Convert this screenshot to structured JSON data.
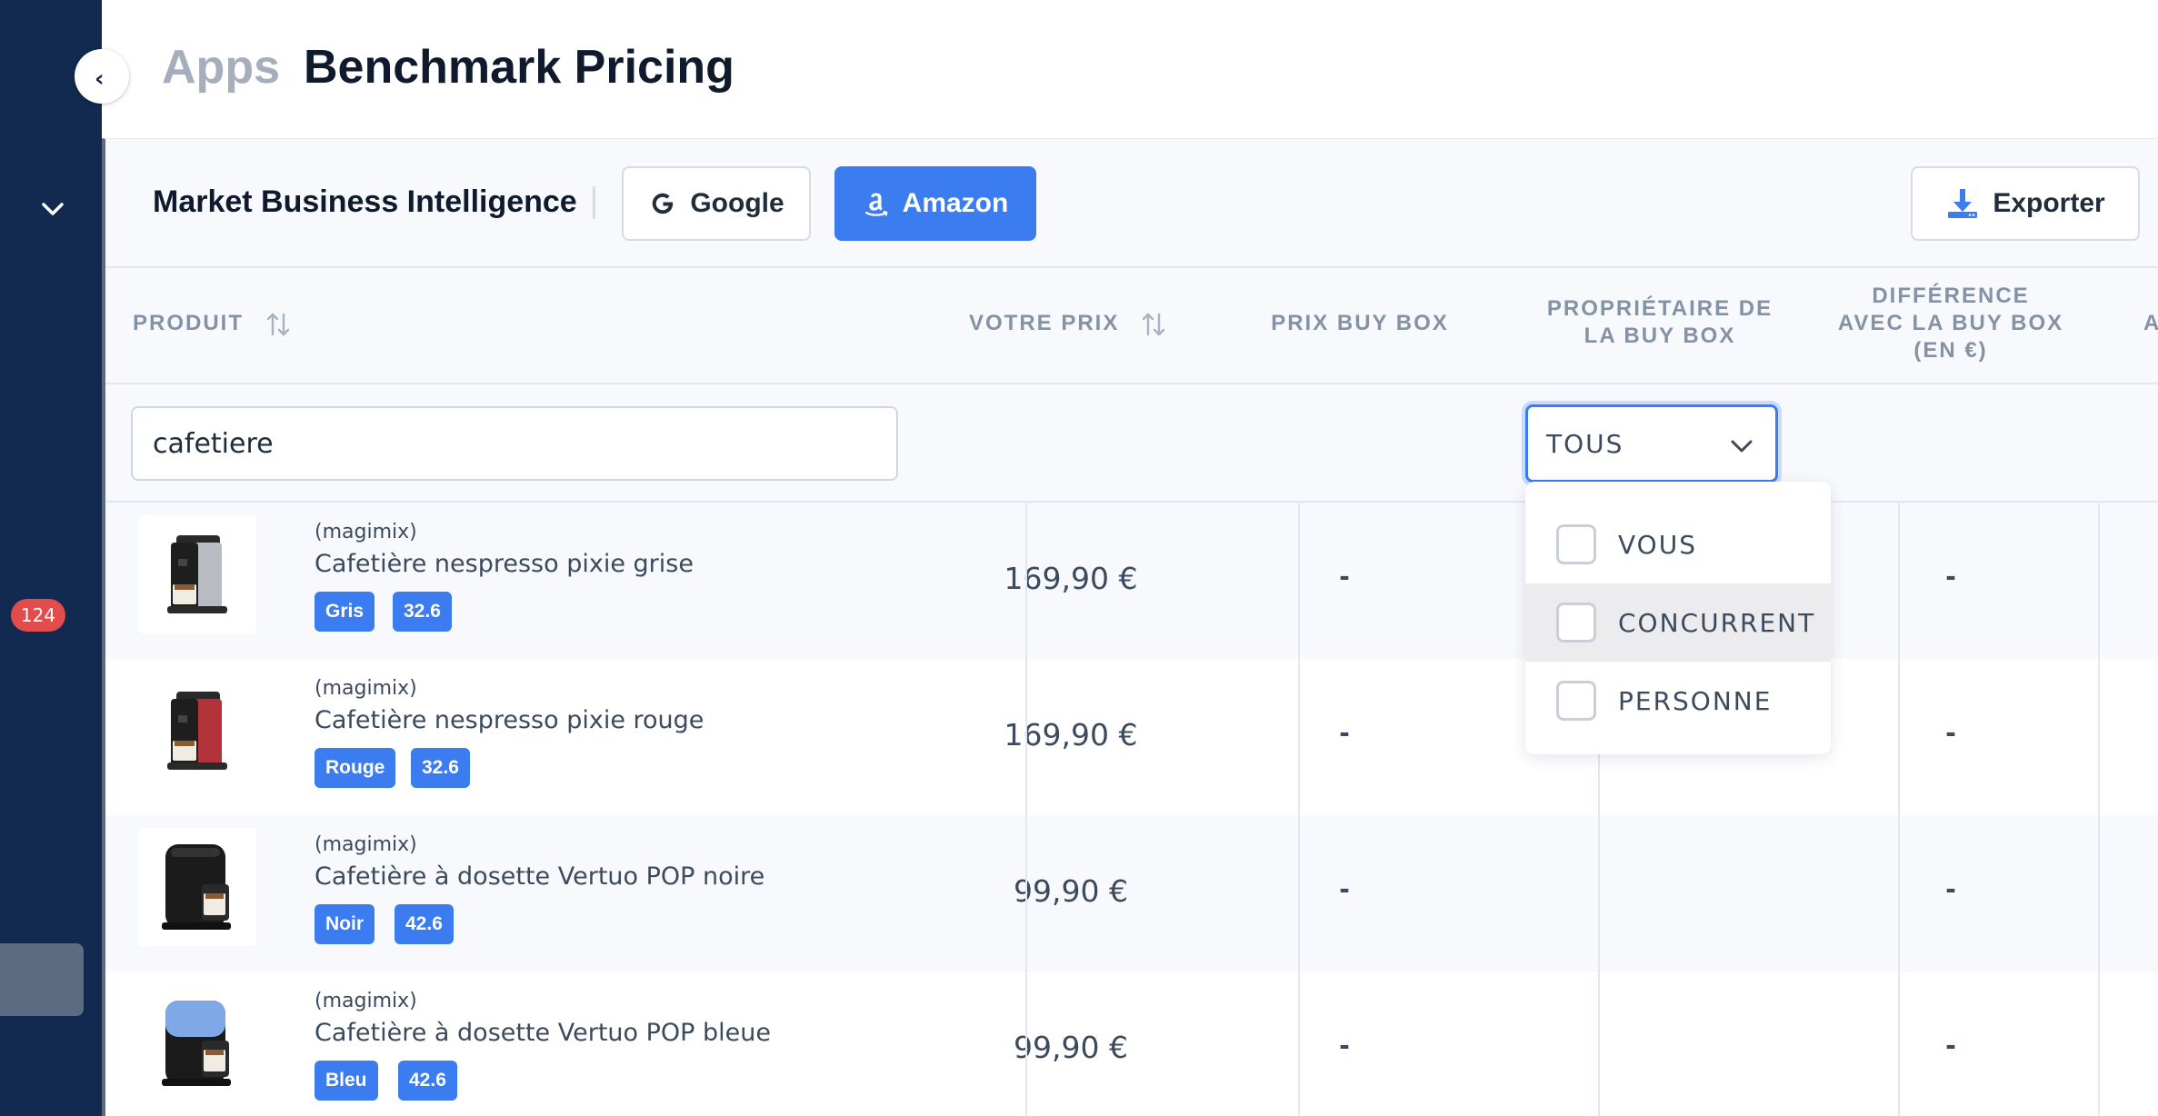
{
  "header": {
    "breadcrumb": "Apps",
    "title": "Benchmark Pricing"
  },
  "sidebar": {
    "badge_count": "124"
  },
  "toolbar": {
    "label": "Market Business Intelligence",
    "google_label": "Google",
    "amazon_label": "Amazon",
    "export_label": "Exporter"
  },
  "table": {
    "columns": {
      "product": "PRODUIT",
      "your_price": "VOTRE PRIX",
      "buybox_price": "PRIX BUY BOX",
      "buybox_owner_l1": "PROPRIÉTAIRE DE",
      "buybox_owner_l2": "LA BUY BOX",
      "diff_l1": "DIFFÉRENCE",
      "diff_l2": "AVEC LA BUY BOX",
      "diff_l3": "(EN €)",
      "next_partial": "A"
    },
    "filters": {
      "search_value": "cafetiere",
      "owner_selected": "TOUS"
    },
    "rows": [
      {
        "brand": "(magimix)",
        "name": "Cafetière nespresso pixie grise",
        "color_tag": "Gris",
        "size_tag": "32.6",
        "price": "169,90 €",
        "buybox_price": "-",
        "diff": "-"
      },
      {
        "brand": "(magimix)",
        "name": "Cafetière nespresso pixie rouge",
        "color_tag": "Rouge",
        "size_tag": "32.6",
        "price": "169,90 €",
        "buybox_price": "-",
        "diff": "-"
      },
      {
        "brand": "(magimix)",
        "name": "Cafetière à dosette Vertuo POP noire",
        "color_tag": "Noir",
        "size_tag": "42.6",
        "price": "99,90 €",
        "buybox_price": "-",
        "diff": "-"
      },
      {
        "brand": "(magimix)",
        "name": "Cafetière à dosette Vertuo POP bleue",
        "color_tag": "Bleu",
        "size_tag": "42.6",
        "price": "99,90 €",
        "buybox_price": "-",
        "diff": "-"
      }
    ]
  },
  "owner_menu": {
    "options": [
      "VOUS",
      "CONCURRENT",
      "PERSONNE"
    ]
  },
  "colors": {
    "sidebar": "#122a4f",
    "accent": "#3b7cf0",
    "badge": "#e24c4b"
  }
}
